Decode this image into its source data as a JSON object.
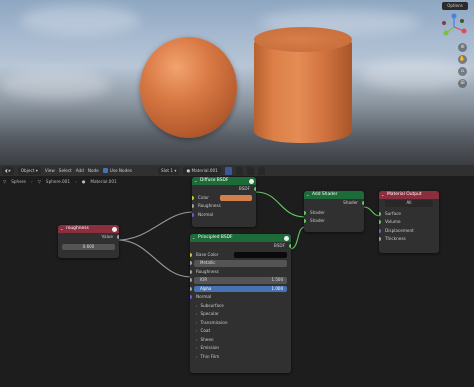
{
  "viewport": {
    "options_label": "Options",
    "gizmo_axes": [
      "X",
      "Y",
      "Z"
    ]
  },
  "header": {
    "mode": "Object",
    "menus": [
      "View",
      "Select",
      "Add",
      "Node"
    ],
    "use_nodes_label": "Use Nodes",
    "slot": "Slot 1",
    "material": "Material.001"
  },
  "breadcrumb": [
    "Sphere",
    "Sphere.001",
    "Material.001"
  ],
  "nodes": {
    "roughness": {
      "title": "roughness",
      "output": "Value",
      "value": "0.600"
    },
    "diffuse": {
      "title": "Diffuse BSDF",
      "output": "BSDF",
      "inputs": [
        "Color",
        "Roughness",
        "Normal"
      ]
    },
    "principled": {
      "title": "Principled BSDF",
      "output": "BSDF",
      "base_color": "Base Color",
      "metallic_label": "Metallic",
      "roughness": "Roughness",
      "ior_label": "IOR",
      "ior_value": "1.500",
      "alpha_label": "Alpha",
      "alpha_value": "1.000",
      "normal": "Normal",
      "sections": [
        "Subsurface",
        "Specular",
        "Transmission",
        "Coat",
        "Sheen",
        "Emission",
        "Thin Film"
      ]
    },
    "add_shader": {
      "title": "Add Shader",
      "output": "Shader",
      "inputs": [
        "Shader",
        "Shader"
      ]
    },
    "material_output": {
      "title": "Material Output",
      "target": "All",
      "inputs": [
        "Surface",
        "Volume",
        "Displacement",
        "Thickness"
      ]
    }
  },
  "colors": {
    "diffuse_color": "#d4804a",
    "principled_base_color": "#0a0a0a",
    "shader_header": "#1e6b3a",
    "output_header": "#8b2f3f",
    "link": "#9a9a9a",
    "shader_link": "#63c763"
  }
}
